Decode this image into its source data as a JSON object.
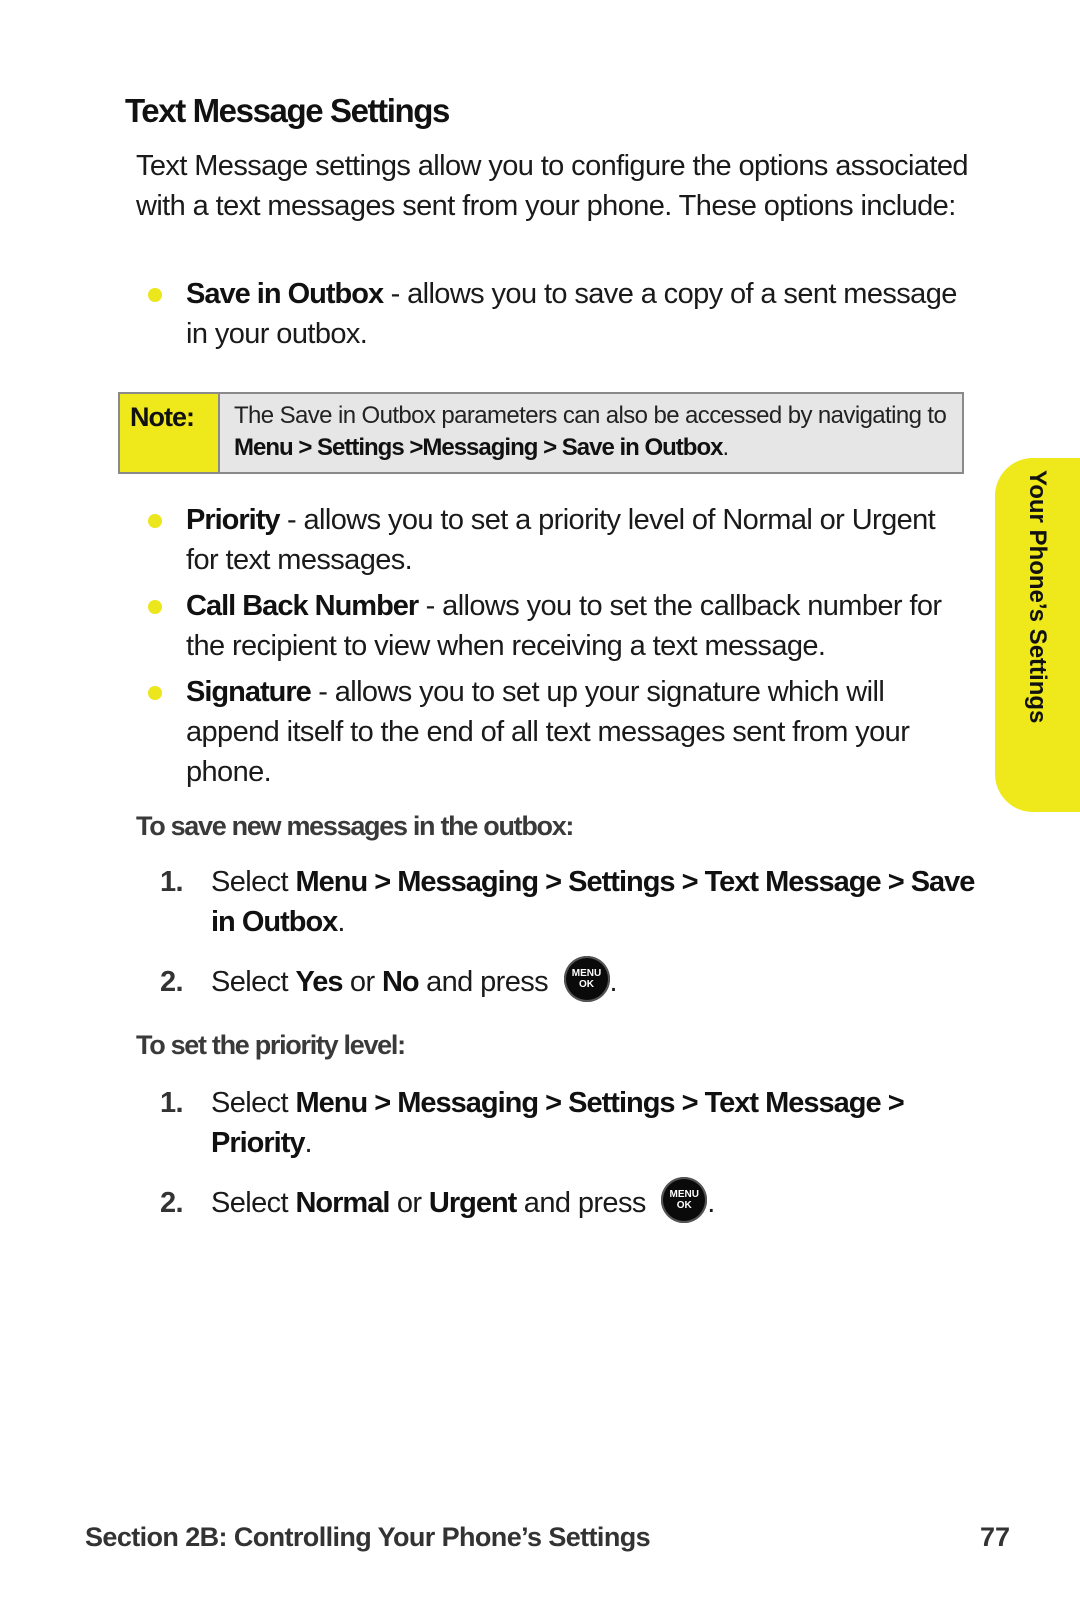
{
  "page": {
    "title": "Text Message Settings",
    "intro": "Text Message settings allow you to configure the options associated with a text messages sent from your phone. These options include:",
    "bullets_a": [
      {
        "term": "Save in Outbox",
        "desc": " - allows you to save a copy of a sent message in your outbox."
      }
    ],
    "note": {
      "label": "Note:",
      "text": "The Save in Outbox parameters can also be accessed by navigating to ",
      "path": "Menu > Settings >Messaging > Save in Outbox",
      "end": "."
    },
    "bullets_b": [
      {
        "term": "Priority",
        "desc": " - allows you to set a priority level of Normal or Urgent for text messages."
      },
      {
        "term": "Call Back Number",
        "desc": " - allows you to set the callback number for the recipient to view when receiving a text message."
      },
      {
        "term": "Signature",
        "desc": " - allows you to set up your signature which will append itself to the end of all text messages sent from your phone."
      }
    ],
    "procedure_1": {
      "heading": "To save new messages in the outbox:",
      "steps": [
        {
          "num": "1.",
          "pre": "Select ",
          "bold": "Menu > Messaging > Settings > Text Message > Save in Outbox",
          "post": "."
        },
        {
          "num": "2.",
          "pre": "Select ",
          "b1": "Yes",
          "mid": " or ",
          "b2": "No",
          "post": " and press"
        }
      ]
    },
    "procedure_2": {
      "heading": "To set the priority level:",
      "steps": [
        {
          "num": "1.",
          "pre": "Select ",
          "bold": "Menu > Messaging > Settings > Text Message > Priority",
          "post": "."
        },
        {
          "num": "2.",
          "pre": "Select ",
          "b1": "Normal",
          "mid": " or ",
          "b2": "Urgent",
          "post": " and press"
        }
      ]
    },
    "menu_key": {
      "line1": "MENU",
      "line2": "OK",
      "icon": "menu-ok-key-icon"
    },
    "side_tab": "Your Phone’s Settings",
    "footer": {
      "section": "Section 2B: Controlling Your Phone’s Settings",
      "page_number": "77"
    },
    "colors": {
      "accent_yellow": "#efe81a",
      "note_bg": "#e6e6e6",
      "note_border": "#8a8a8a"
    }
  }
}
